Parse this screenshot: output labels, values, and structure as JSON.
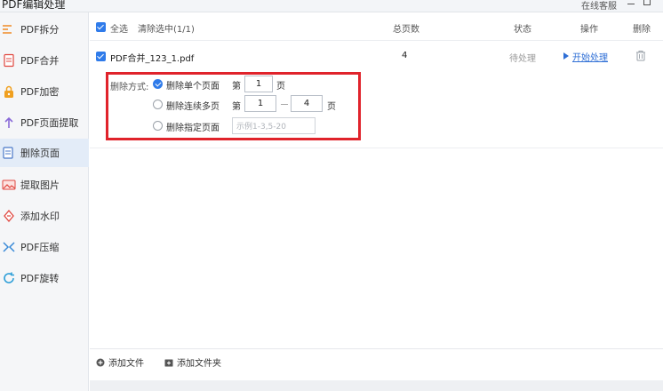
{
  "window": {
    "title": "PDF编辑处理",
    "online_service": "在线客服"
  },
  "sidebar": {
    "items": [
      {
        "label": "PDF拆分",
        "icon": "split-icon"
      },
      {
        "label": "PDF合并",
        "icon": "merge-icon"
      },
      {
        "label": "PDF加密",
        "icon": "lock-icon"
      },
      {
        "label": "PDF页面提取",
        "icon": "extract-page-icon"
      },
      {
        "label": "删除页面",
        "icon": "delete-page-icon",
        "active": true
      },
      {
        "label": "提取图片",
        "icon": "image-icon"
      },
      {
        "label": "添加水印",
        "icon": "watermark-icon"
      },
      {
        "label": "PDF压缩",
        "icon": "compress-icon"
      },
      {
        "label": "PDF旋转",
        "icon": "rotate-icon"
      }
    ]
  },
  "header": {
    "select_all": "全选",
    "clear_selected": "清除选中(1/1)",
    "col_total_pages": "总页数",
    "col_status": "状态",
    "col_action": "操作",
    "col_delete": "删除"
  },
  "file": {
    "name": "PDF合并_123_1.pdf",
    "total_pages": "4",
    "status": "待处理",
    "action": "开始处理"
  },
  "delete_options": {
    "label": "删除方式:",
    "single": {
      "label": "删除单个页面",
      "prefix": "第",
      "value": "1",
      "suffix": "页",
      "selected": true
    },
    "range": {
      "label": "删除连续多页",
      "prefix": "第",
      "from": "1",
      "to": "4",
      "suffix": "页",
      "selected": false
    },
    "custom": {
      "label": "删除指定页面",
      "placeholder": "示例1-3,5-20",
      "selected": false
    }
  },
  "footer": {
    "add_file": "添加文件",
    "add_folder": "添加文件夹"
  },
  "colors": {
    "accent": "#2f7bea",
    "highlight_border": "#e0232b",
    "link": "#2f6fd6"
  }
}
